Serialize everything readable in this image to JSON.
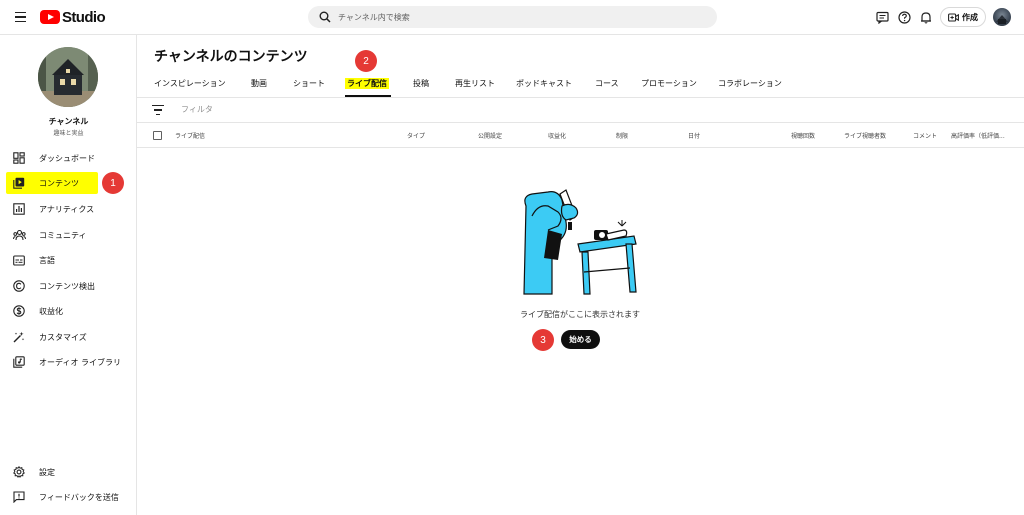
{
  "header": {
    "logo_text": "Studio",
    "search_placeholder": "チャンネル内で検索",
    "create_label": "作成"
  },
  "sidebar": {
    "channel_name": "チャンネル",
    "channel_sub": "趣味と実益",
    "items": [
      {
        "label": "ダッシュボード",
        "icon": "dashboard-icon"
      },
      {
        "label": "コンテンツ",
        "icon": "content-icon",
        "active": true
      },
      {
        "label": "アナリティクス",
        "icon": "analytics-icon"
      },
      {
        "label": "コミュニティ",
        "icon": "community-icon"
      },
      {
        "label": "言語",
        "icon": "subtitles-icon"
      },
      {
        "label": "コンテンツ検出",
        "icon": "copyright-icon"
      },
      {
        "label": "収益化",
        "icon": "monetization-icon"
      },
      {
        "label": "カスタマイズ",
        "icon": "customize-icon"
      },
      {
        "label": "オーディオ ライブラリ",
        "icon": "audio-library-icon"
      }
    ],
    "footer_items": [
      {
        "label": "設定",
        "icon": "settings-icon"
      },
      {
        "label": "フィードバックを送信",
        "icon": "feedback-icon"
      }
    ]
  },
  "main": {
    "title": "チャンネルのコンテンツ",
    "tabs": [
      "インスピレーション",
      "動画",
      "ショート",
      "ライブ配信",
      "投稿",
      "再生リスト",
      "ポッドキャスト",
      "コース",
      "プロモーション",
      "コラボレーション"
    ],
    "active_tab": "ライブ配信",
    "filter_placeholder": "フィルタ",
    "columns": [
      "ライブ配信",
      "タイプ",
      "公開設定",
      "収益化",
      "制限",
      "日付",
      "視聴回数",
      "ライブ視聴者数",
      "コメント",
      "高評価率（低評価..."
    ],
    "empty_message": "ライブ配信がここに表示されます",
    "start_button": "始める"
  },
  "annotations": {
    "badge_1": "1",
    "badge_2": "2",
    "badge_3": "3"
  },
  "colors": {
    "highlight": "#ffff00",
    "badge": "#e53935",
    "illustration": "#3ccbf4",
    "brand": "#ff0000"
  }
}
